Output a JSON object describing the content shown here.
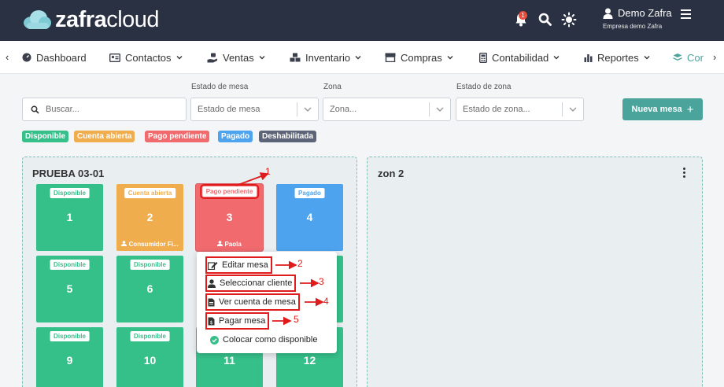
{
  "brand": {
    "logo_light": "zafra",
    "logo_bold": "cloud"
  },
  "header": {
    "notification_count": "1",
    "user_name": "Demo Zafra",
    "company": "Empresa demo Zafra"
  },
  "nav": {
    "items": [
      "Dashboard",
      "Contactos",
      "Ventas",
      "Inventario",
      "Compras",
      "Contabilidad",
      "Reportes",
      "Cor"
    ]
  },
  "filters": {
    "search_placeholder": "Buscar...",
    "estado_mesa_label": "Estado de mesa",
    "estado_mesa_placeholder": "Estado de mesa",
    "zona_label": "Zona",
    "zona_placeholder": "Zona...",
    "estado_zona_label": "Estado de zona",
    "estado_zona_placeholder": "Estado de zona...",
    "new_button": "Nueva mesa"
  },
  "legend": [
    "Disponible",
    "Cuenta abierta",
    "Pago pendiente",
    "Pagado",
    "Deshabilitada"
  ],
  "zones": [
    {
      "name": "PRUEBA 03-01",
      "tables": [
        {
          "status": "Disponible",
          "number": "1",
          "client": ""
        },
        {
          "status": "Cuenta abierta",
          "number": "2",
          "client": "Consumidor Fi..."
        },
        {
          "status": "Pago pendiente",
          "number": "3",
          "client": "Paola"
        },
        {
          "status": "Pagado",
          "number": "4",
          "client": ""
        },
        {
          "status": "Disponible",
          "number": "5",
          "client": ""
        },
        {
          "status": "Disponible",
          "number": "6",
          "client": ""
        },
        {
          "status": "Disponible",
          "number": "9",
          "client": ""
        },
        {
          "status": "Disponible",
          "number": "10",
          "client": ""
        },
        {
          "status": "",
          "number": "11",
          "client": ""
        },
        {
          "status": "",
          "number": "12",
          "client": ""
        }
      ]
    },
    {
      "name": "zon 2",
      "tables": []
    }
  ],
  "context_menu": {
    "items": [
      "Editar mesa",
      "Seleccionar cliente",
      "Ver cuenta de mesa",
      "Pagar mesa",
      "Colocar como disponible"
    ]
  },
  "annotations": [
    "1",
    "2",
    "3",
    "4",
    "5"
  ],
  "colors": {
    "header_bg": "#2a3142",
    "accent": "#4aa49b",
    "disponible": "#35c08a",
    "cuenta_abierta": "#f0ad4e",
    "pago_pendiente": "#f06a6e",
    "pagado": "#4da3ee",
    "deshabilitada": "#5d6477",
    "annotation_red": "#e01b1b"
  }
}
